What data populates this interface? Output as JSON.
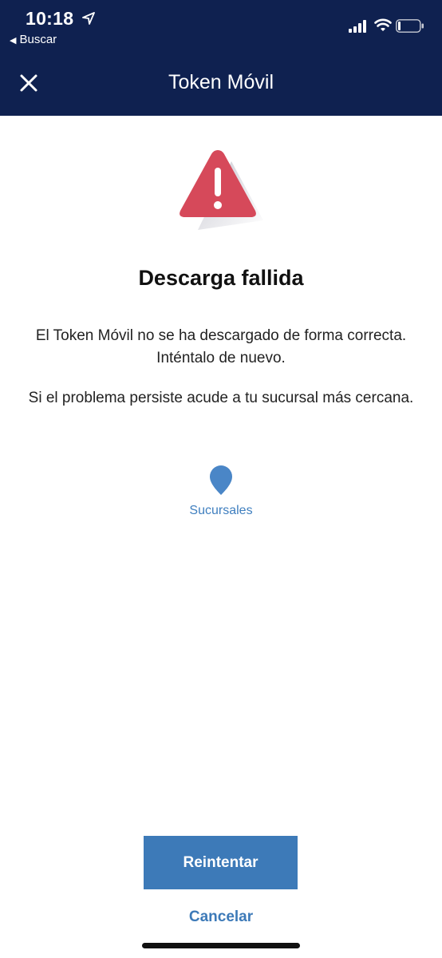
{
  "status_bar": {
    "time": "10:18",
    "back_app": "Buscar",
    "icons": [
      "location-arrow-icon",
      "signal-icon",
      "wifi-icon",
      "battery-icon"
    ]
  },
  "header": {
    "title": "Token Móvil",
    "close_icon": "close-icon"
  },
  "content": {
    "heading": "Descarga fallida",
    "message_1": "El Token Móvil no se ha descargado de forma correcta. Inténtalo de nuevo.",
    "message_2": "Si el problema persiste acude a tu sucursal más cercana.",
    "branches_label": "Sucursales"
  },
  "actions": {
    "retry_label": "Reintentar",
    "cancel_label": "Cancelar"
  },
  "colors": {
    "header_bg": "#0f2150",
    "accent": "#3d7ab8",
    "warning": "#d6495a"
  }
}
